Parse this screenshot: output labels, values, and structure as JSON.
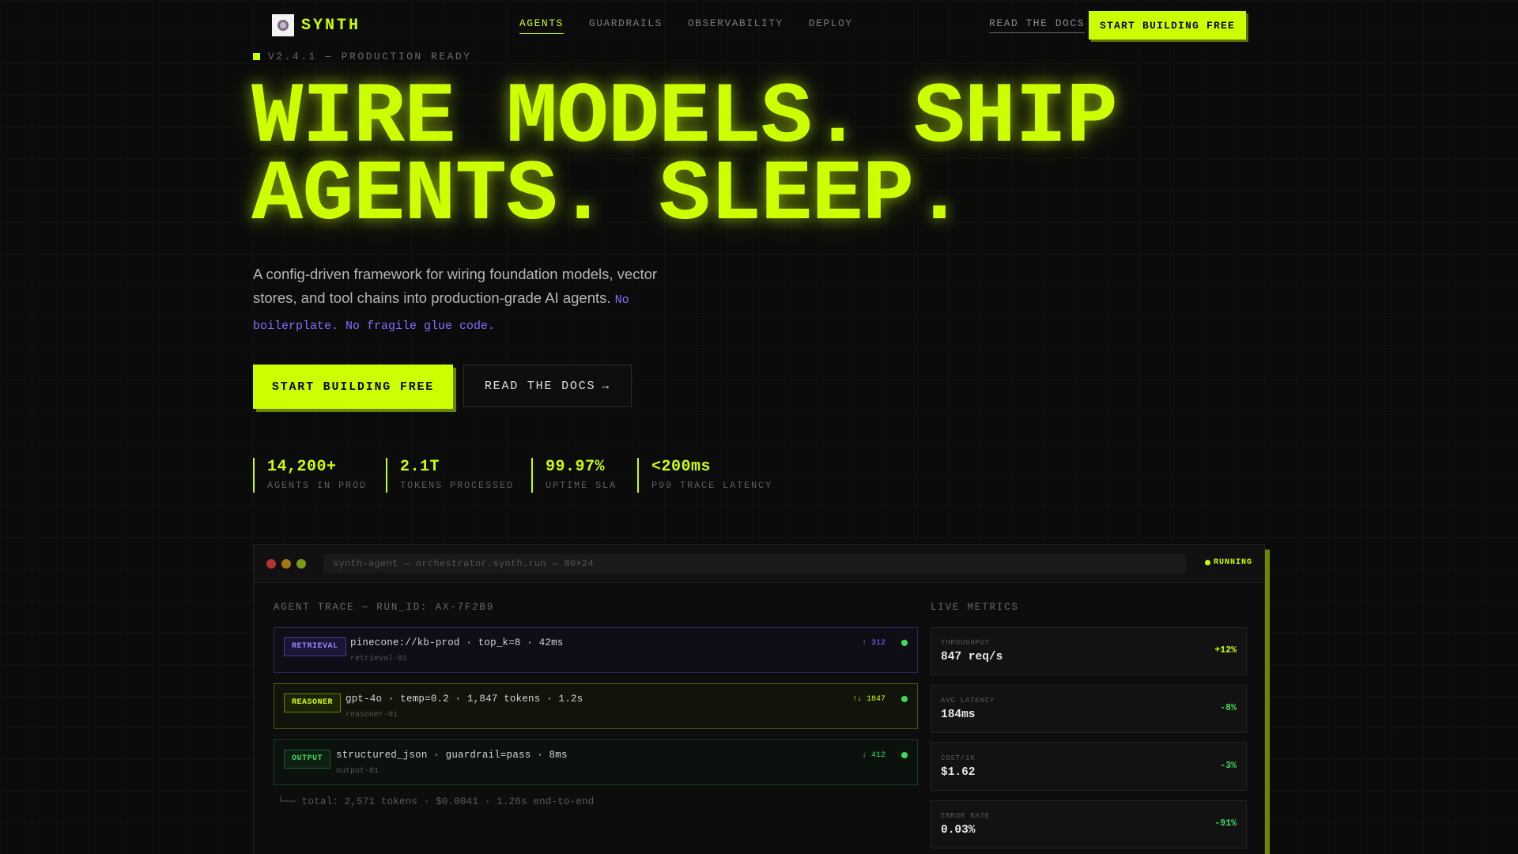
{
  "brand": {
    "name": "SYNTH",
    "accent": "#ccff00"
  },
  "nav": {
    "links": [
      "AGENTS",
      "GUARDRAILS",
      "OBSERVABILITY",
      "DEPLOY"
    ],
    "docs_label": "READ THE DOCS",
    "cta_label": "START BUILDING FREE"
  },
  "hero": {
    "version": "V2.4.1 — PRODUCTION READY",
    "headline_line1": "WIRE MODELS. SHIP",
    "headline_line2": "AGENTS. SLEEP.",
    "lede_text": "A config-driven framework for wiring foundation models, vector stores, and tool chains into production-grade AI agents. ",
    "lede_highlight": "No boilerplate. No fragile glue code.",
    "primary_cta": "START BUILDING FREE",
    "secondary_cta": "READ THE DOCS",
    "secondary_arrow": "→"
  },
  "stats": [
    {
      "value": "14,200+",
      "label": "AGENTS IN PROD"
    },
    {
      "value": "2.1T",
      "label": "TOKENS PROCESSED"
    },
    {
      "value": "99.97%",
      "label": "UPTIME SLA"
    },
    {
      "value": "<200ms",
      "label": "P99 TRACE LATENCY"
    }
  ],
  "terminal": {
    "address": "synth-agent — orchestrator.synth.run — 80×24",
    "status": "RUNNING",
    "trace_label": "AGENT TRACE — RUN_ID: AX-7F2B9",
    "metrics_label": "LIVE METRICS",
    "trace": [
      {
        "badge": "RETRIEVAL",
        "main": "pinecone://kb-prod · top_k=8 · 42ms",
        "sub": "retrieval-01",
        "meta": "↑ 312"
      },
      {
        "badge": "REASONER",
        "main": "gpt-4o · temp=0.2 · 1,847 tokens · 1.2s",
        "sub": "reasoner-01",
        "meta": "↑↓ 1847"
      },
      {
        "badge": "OUTPUT",
        "main": "structured_json · guardrail=pass · 8ms",
        "sub": "output-01",
        "meta": "↓ 412"
      }
    ],
    "total": "└── total: 2,571 tokens · $0.0041 · 1.26s end-to-end",
    "metrics": [
      {
        "label": "THROUGHPUT",
        "value": "847 req/s",
        "delta": "+12%"
      },
      {
        "label": "AVG LATENCY",
        "value": "184ms",
        "delta": "-8%"
      },
      {
        "label": "COST/1K",
        "value": "$1.62",
        "delta": "-3%"
      },
      {
        "label": "ERROR RATE",
        "value": "0.03%",
        "delta": "-91%"
      }
    ]
  }
}
